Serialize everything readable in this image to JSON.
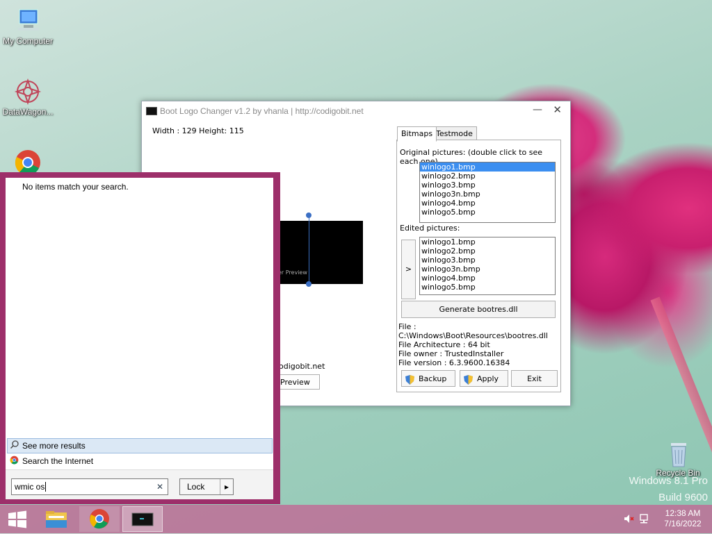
{
  "desktop": {
    "icons": [
      {
        "label": "My Computer"
      },
      {
        "label": "DataWagon..."
      },
      {
        "label": "Recycle Bin"
      }
    ],
    "watermark_line1": "Windows 8.1 Pro",
    "watermark_line2": "Build 9600"
  },
  "app_window": {
    "title": "Boot Logo Changer v1.2 by vhanla | http://codigobit.net",
    "dimensions": "Width : 129  Height: 115",
    "preview_caption": "er Preview",
    "credit_text": "odigobit.net",
    "preview_button": "Preview",
    "tabs": [
      {
        "label": "Bitmaps"
      },
      {
        "label": "Testmode"
      }
    ],
    "original_label": "Original pictures: (double click to see each one)",
    "original_items": [
      "winlogo1.bmp",
      "winlogo2.bmp",
      "winlogo3.bmp",
      "winlogo3n.bmp",
      "winlogo4.bmp",
      "winlogo5.bmp"
    ],
    "edited_label": "Edited pictures:",
    "edited_items": [
      "winlogo1.bmp",
      "winlogo2.bmp",
      "winlogo3.bmp",
      "winlogo3n.bmp",
      "winlogo4.bmp",
      "winlogo5.bmp"
    ],
    "arrow_button": ">",
    "generate_button": "Generate bootres.dll",
    "file_info": {
      "file": "File : C:\\Windows\\Boot\\Resources\\bootres.dll",
      "arch": "File Architecture : 64 bit",
      "owner": "File owner : TrustedInstaller",
      "version": "File version : 6.3.9600.16384"
    },
    "backup_button": "Backup",
    "apply_button": "Apply",
    "exit_button": "Exit",
    "selected_original_index": 0
  },
  "start_search": {
    "no_items": "No items match your search.",
    "see_more": "See more results",
    "search_internet": "Search the Internet",
    "query": "wmic os",
    "lock_button": "Lock",
    "lock_arrow": "▸"
  },
  "taskbar": {
    "time": "12:38 AM",
    "date": "7/16/2022"
  },
  "colors": {
    "start_pane": "#9d2f6a",
    "selection": "#3b8ef0",
    "taskbar": "#be6e96"
  }
}
